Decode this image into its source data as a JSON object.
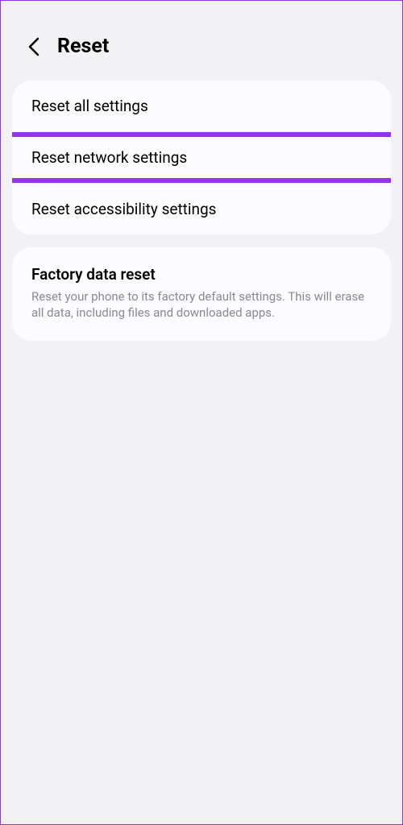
{
  "header": {
    "title": "Reset"
  },
  "section1": {
    "items": [
      {
        "label": "Reset all settings"
      },
      {
        "label": "Reset network settings"
      },
      {
        "label": "Reset accessibility settings"
      }
    ]
  },
  "section2": {
    "factory": {
      "title": "Factory data reset",
      "description": "Reset your phone to its factory default settings. This will erase all data, including files and downloaded apps."
    }
  }
}
